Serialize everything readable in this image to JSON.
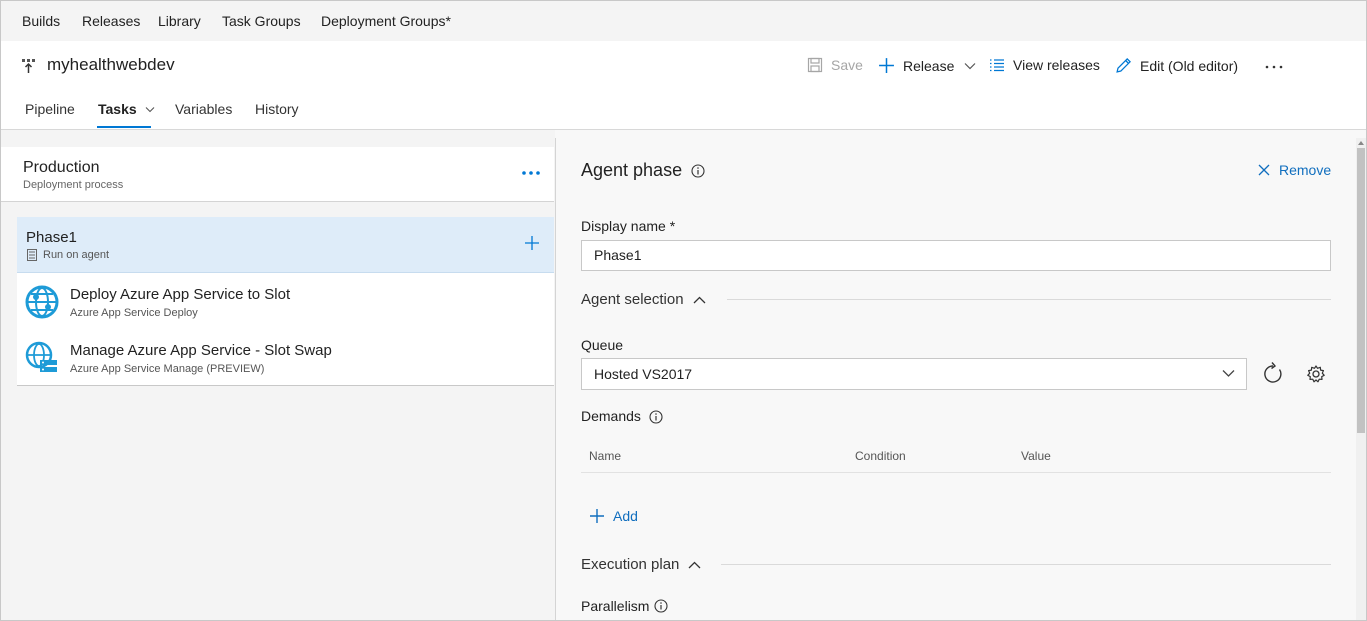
{
  "hub_nav": {
    "items": [
      "Builds",
      "Releases",
      "Library",
      "Task Groups",
      "Deployment Groups*"
    ]
  },
  "header": {
    "title": "myhealthwebdev",
    "toolbar": {
      "save_label": "Save",
      "release_label": "Release",
      "view_releases_label": "View releases",
      "edit_label": "Edit (Old editor)"
    },
    "tabs": [
      "Pipeline",
      "Tasks",
      "Variables",
      "History"
    ],
    "active_tab": "Tasks"
  },
  "stage": {
    "name": "Production",
    "subtitle": "Deployment process"
  },
  "phase": {
    "name": "Phase1",
    "subtitle": "Run on agent"
  },
  "tasks": [
    {
      "name": "Deploy Azure App Service to Slot",
      "subtitle": "Azure App Service Deploy"
    },
    {
      "name": "Manage Azure App Service - Slot Swap",
      "subtitle": "Azure App Service Manage (PREVIEW)"
    }
  ],
  "details": {
    "title": "Agent phase",
    "remove_label": "Remove",
    "display_name_label": "Display name *",
    "display_name_value": "Phase1",
    "agent_selection_label": "Agent selection",
    "queue_label": "Queue",
    "queue_value": "Hosted VS2017",
    "demands_label": "Demands",
    "demands_columns": [
      "Name",
      "Condition",
      "Value"
    ],
    "add_label": "Add",
    "execution_plan_label": "Execution plan",
    "parallelism_label": "Parallelism"
  },
  "colors": {
    "accent": "#0078d4",
    "link": "#106ebe",
    "selected_row": "#deecf9",
    "azure_icon": "#1e9bd7"
  },
  "icons": {
    "release_definition": "release-definition-icon",
    "save": "save-icon",
    "add": "plus-icon",
    "list": "list-icon",
    "edit": "pencil-icon",
    "more": "ellipsis-icon",
    "info": "info-icon",
    "close": "close-icon",
    "refresh": "refresh-icon",
    "settings": "gear-icon",
    "server": "server-icon",
    "azure_app_service": "azure-app-service-icon"
  }
}
